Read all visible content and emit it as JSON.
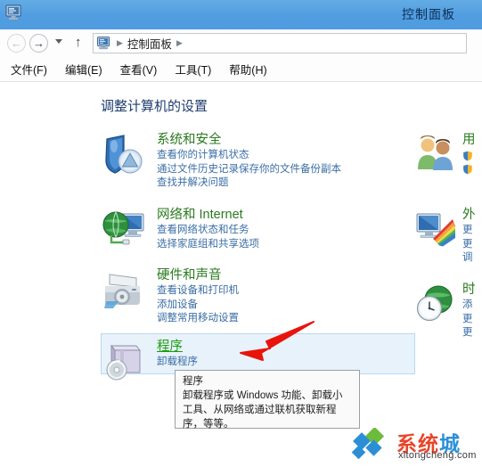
{
  "window": {
    "title": "控制面板",
    "icon": "control-panel-icon"
  },
  "navigation": {
    "back_icon": "back-arrow-icon",
    "forward_icon": "forward-arrow-icon",
    "history_icon": "chevron-down-icon",
    "up_icon": "up-arrow-icon",
    "address_icon": "control-panel-icon",
    "breadcrumb": [
      "控制面板"
    ],
    "separator": "▶"
  },
  "menubar": {
    "items": [
      {
        "label": "文件(F)"
      },
      {
        "label": "编辑(E)"
      },
      {
        "label": "查看(V)"
      },
      {
        "label": "工具(T)"
      },
      {
        "label": "帮助(H)"
      }
    ]
  },
  "main": {
    "heading": "调整计算机的设置",
    "categories": [
      {
        "title": "系统和安全",
        "icon": "shield-icon",
        "links": [
          "查看你的计算机状态",
          "通过文件历史记录保存你的文件备份副本",
          "查找并解决问题"
        ]
      },
      {
        "title": "网络和 Internet",
        "icon": "network-globe-icon",
        "links": [
          "查看网络状态和任务",
          "选择家庭组和共享选项"
        ]
      },
      {
        "title": "硬件和声音",
        "icon": "printer-icon",
        "links": [
          "查看设备和打印机",
          "添加设备",
          "调整常用移动设置"
        ]
      },
      {
        "title": "程序",
        "icon": "programs-box-icon",
        "highlighted": true,
        "links": [
          "卸载程序"
        ]
      }
    ],
    "right_categories": [
      {
        "title": "用",
        "icon": "user-accounts-icon",
        "links": [
          "",
          ""
        ],
        "shields": true
      },
      {
        "title": "外",
        "icon": "appearance-monitor-icon",
        "links": [
          "更",
          "更",
          "调"
        ]
      },
      {
        "title": "时",
        "icon": "clock-globe-icon",
        "links": [
          "添",
          "更",
          "更"
        ]
      }
    ]
  },
  "tooltip": {
    "title": "程序",
    "description": "卸载程序或 Windows 功能、卸载小工具、从网络或通过联机获取新程序，等等。"
  },
  "annotation": {
    "arrow_icon": "red-arrow-pointer",
    "arrow_color": "#e8140c"
  },
  "watermark": {
    "logo_icon": "diamond-logo-icon",
    "brand_red": "系统",
    "brand_blue": "城",
    "domain": "xitongcheng.com"
  },
  "colors": {
    "titlebar": "#519de0",
    "category_title": "#2a7a1e",
    "link": "#3b6ea5",
    "heading": "#1f3d6e",
    "hover_fill": "#e8f2fb",
    "hover_border": "#b9d8ef"
  }
}
